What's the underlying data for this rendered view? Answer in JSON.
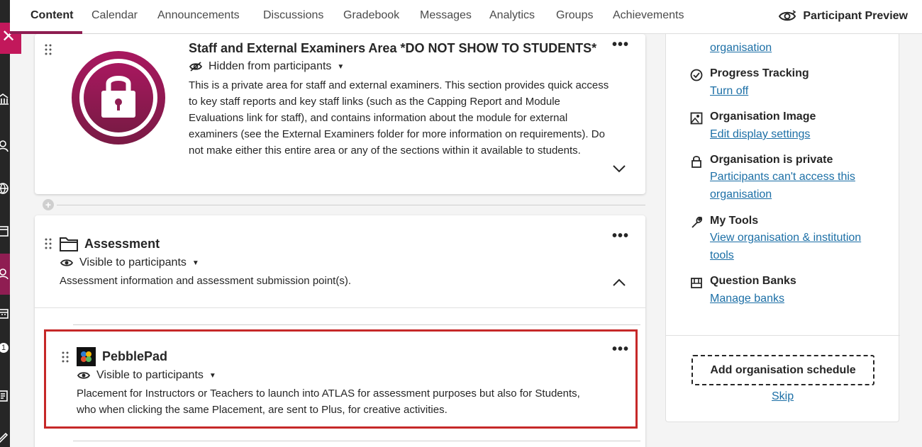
{
  "nav": {
    "tabs": [
      "Content",
      "Calendar",
      "Announcements",
      "Discussions",
      "Gradebook",
      "Messages",
      "Analytics",
      "Groups",
      "Achievements"
    ],
    "participant_preview": "Participant Preview"
  },
  "rail": {
    "badge_count": "1"
  },
  "sections": {
    "staff": {
      "title": "Staff and External Examiners Area *DO NOT SHOW TO STUDENTS*",
      "visibility": "Hidden from participants",
      "description": "This is a private area for staff and external examiners. This section provides quick access to key staff reports and key staff links (such as the Capping Report and Module Evaluations link for staff), and contains information about the module for external examiners (see the External Examiners folder for more information on requirements). Do not make either this entire area or any of the sections within it available to students."
    },
    "assessment": {
      "title": "Assessment",
      "visibility": "Visible to participants",
      "description": "Assessment information and assessment submission point(s)."
    },
    "pebblepad": {
      "title": "PebblePad",
      "visibility": "Visible to participants",
      "description": "Placement for Instructors or Teachers to launch into ATLAS for assessment purposes but also for Students, who when clicking the same Placement, are sent to Plus, for creative activities."
    }
  },
  "panel": {
    "top_link": "organisation",
    "items": [
      {
        "heading": "Progress Tracking",
        "link": "Turn off"
      },
      {
        "heading": "Organisation Image",
        "link": "Edit display settings"
      },
      {
        "heading": "Organisation is private",
        "link_line1": "Participants can't access this",
        "link_line2": "organisation"
      },
      {
        "heading": "My Tools",
        "link_line1": "View organisation & institution",
        "link_line2": "tools"
      },
      {
        "heading": "Question Banks",
        "link": "Manage banks"
      }
    ],
    "schedule_button": "Add organisation schedule",
    "skip": "Skip"
  },
  "colors": {
    "accent": "#8f1d52",
    "link": "#1c6fa6",
    "highlight": "#c62828"
  }
}
